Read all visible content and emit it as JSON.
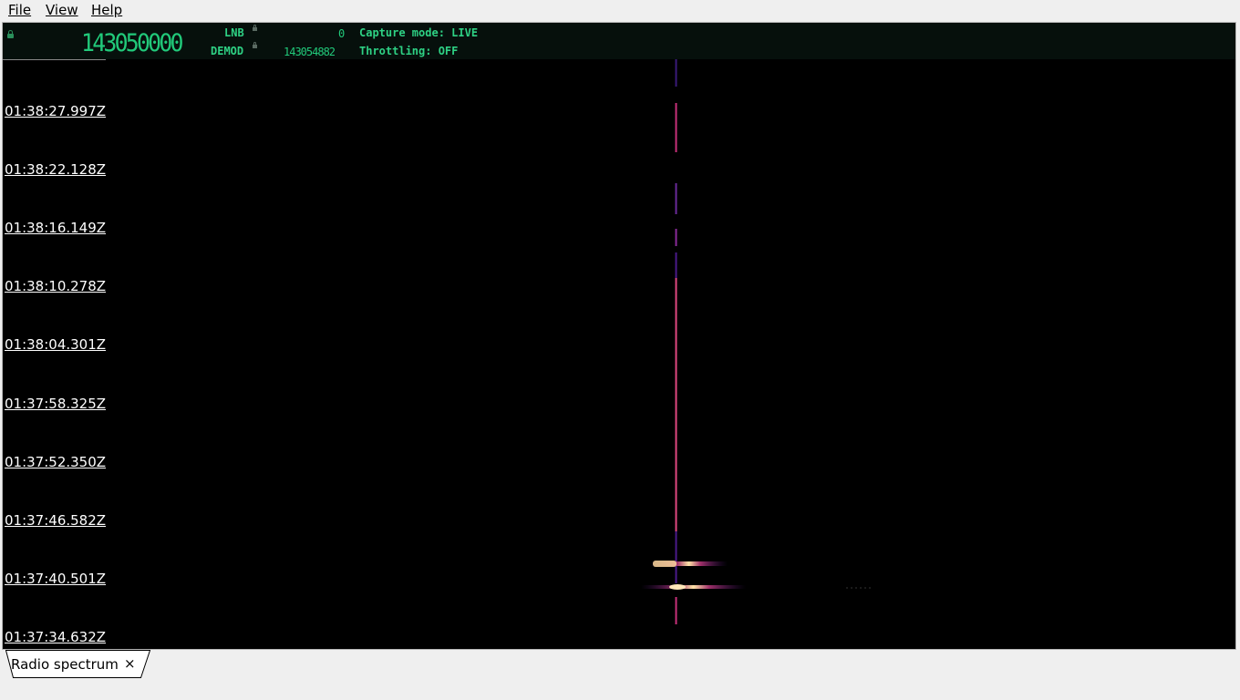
{
  "menu": {
    "file": "File",
    "view": "View",
    "help": "Help"
  },
  "toolbar": {
    "frequency": "143050000",
    "lnb_label": "LNB",
    "lnb_value": "0",
    "demod_label": "DEMOD",
    "demod_value": "143054882",
    "capture_mode": "Capture mode: LIVE",
    "throttling": "Throttling: OFF"
  },
  "timestamps": [
    "01:38:27.997Z",
    "01:38:22.128Z",
    "01:38:16.149Z",
    "01:38:10.278Z",
    "01:38:04.301Z",
    "01:37:58.325Z",
    "01:37:52.350Z",
    "01:37:46.582Z",
    "01:37:40.501Z",
    "01:37:34.632Z"
  ],
  "tabs": [
    {
      "label": "Radio spectrum",
      "close": "×"
    }
  ],
  "colors": {
    "background": "#000000",
    "lcd": "#21c97a",
    "signal": "#e0407a",
    "hot": "#ffe0a0"
  }
}
